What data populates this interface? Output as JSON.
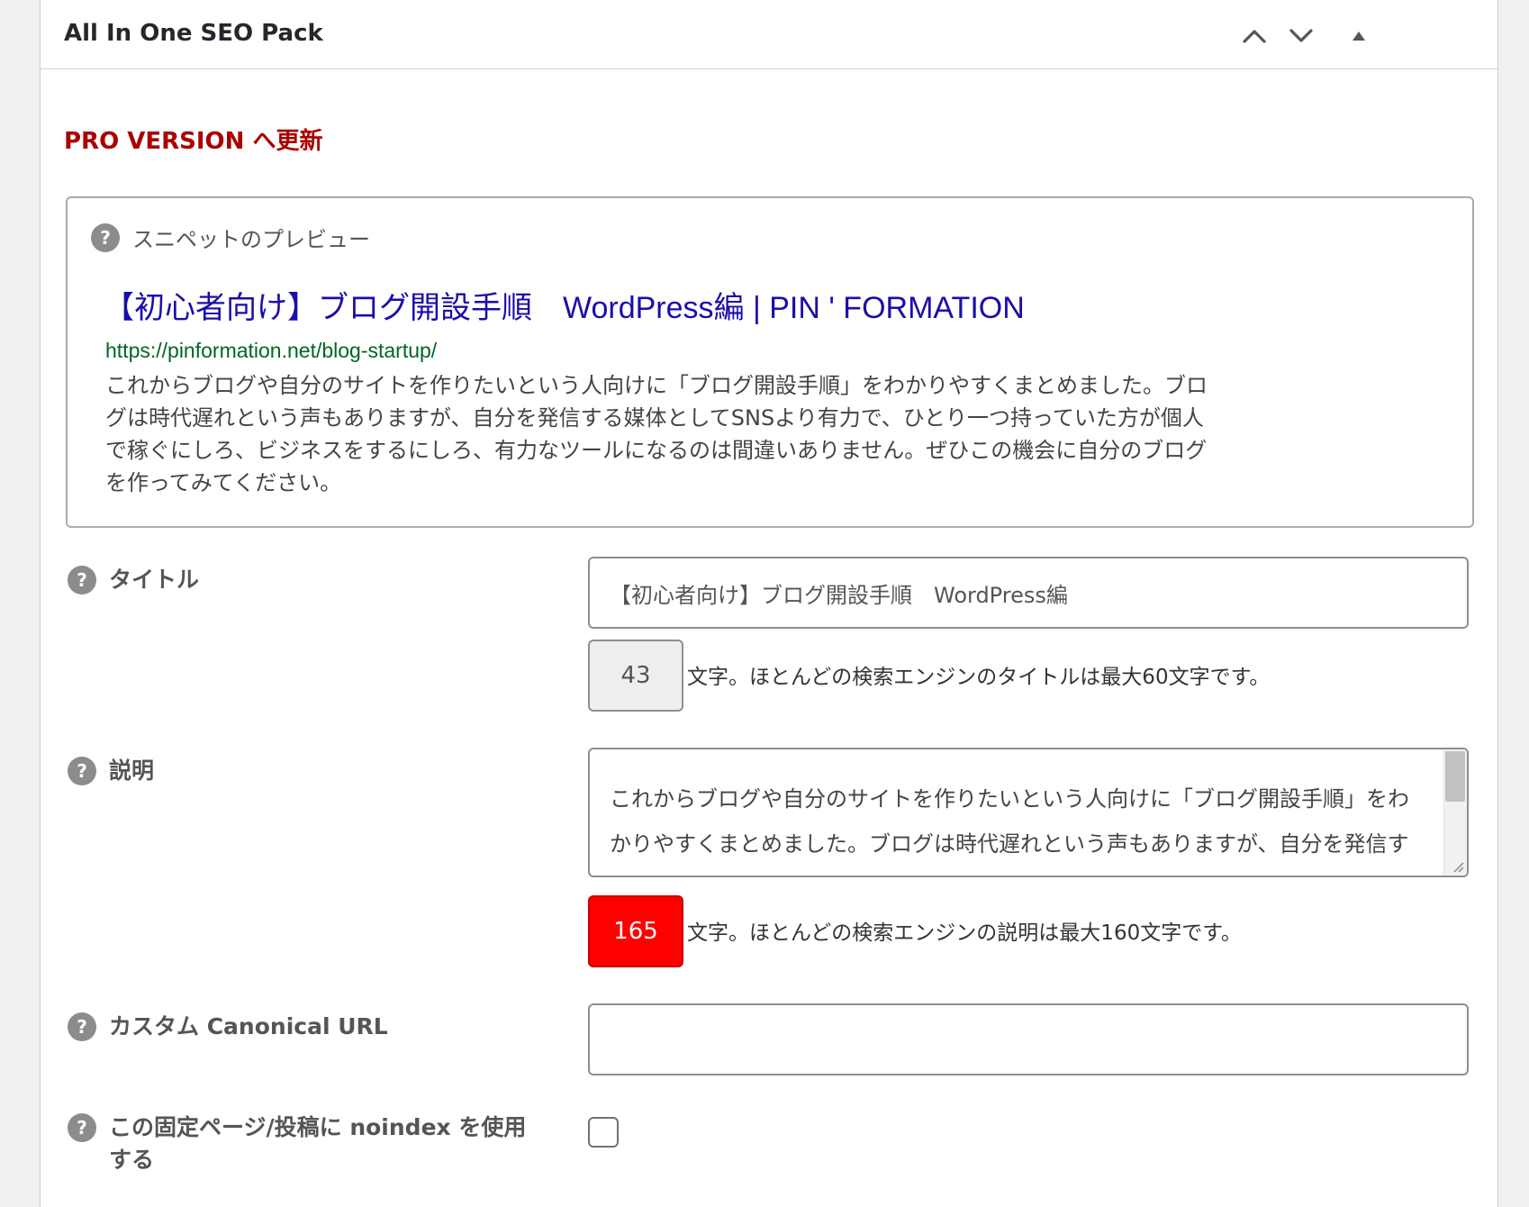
{
  "header": {
    "title": "All In One SEO Pack",
    "move_up_icon": "chevron-up-icon",
    "move_down_icon": "chevron-down-icon",
    "toggle_icon": "triangle-up-icon"
  },
  "pro_link": "PRO VERSION へ更新",
  "preview": {
    "label": "スニペットのプレビュー",
    "title": "【初心者向け】ブログ開設手順　WordPress編 | PIN ' FORMATION",
    "url": "https://pinformation.net/blog-startup/",
    "description": "これからブログや自分のサイトを作りたいという人向けに「ブログ開設手順」をわかりやすくまとめました。ブログは時代遅れという声もありますが、自分を発信する媒体としてSNSより有力で、ひとり一つ持っていた方が個人で稼ぐにしろ、ビジネスをするにしろ、有力なツールになるのは間違いありません。ぜひこの機会に自分のブログを作ってみてください。"
  },
  "fields": {
    "title": {
      "label": "タイトル",
      "value": "【初心者向け】ブログ開設手順　WordPress編",
      "count": "43",
      "note": "文字。ほとんどの検索エンジンのタイトルは最大60文字です。"
    },
    "description": {
      "label": "説明",
      "value": "これからブログや自分のサイトを作りたいという人向けに「ブログ開設手順」をわかりやすくまとめました。ブログは時代遅れという声もありますが、自分を発信する媒体としてSNSより有力で、ひとり一つ持っていた方が個人で稼ぐ",
      "count": "165",
      "note": "文字。ほとんどの検索エンジンの説明は最大160文字です。"
    },
    "canonical": {
      "label": "カスタム Canonical URL",
      "value": ""
    },
    "noindex": {
      "label": "この固定ページ/投稿に noindex を使用する",
      "checked": false
    }
  },
  "colors": {
    "pro_link": "#aa0000",
    "snippet_title": "#1a0dab",
    "snippet_url": "#006621",
    "counter_over": "#ff0000"
  },
  "help_glyph": "?"
}
